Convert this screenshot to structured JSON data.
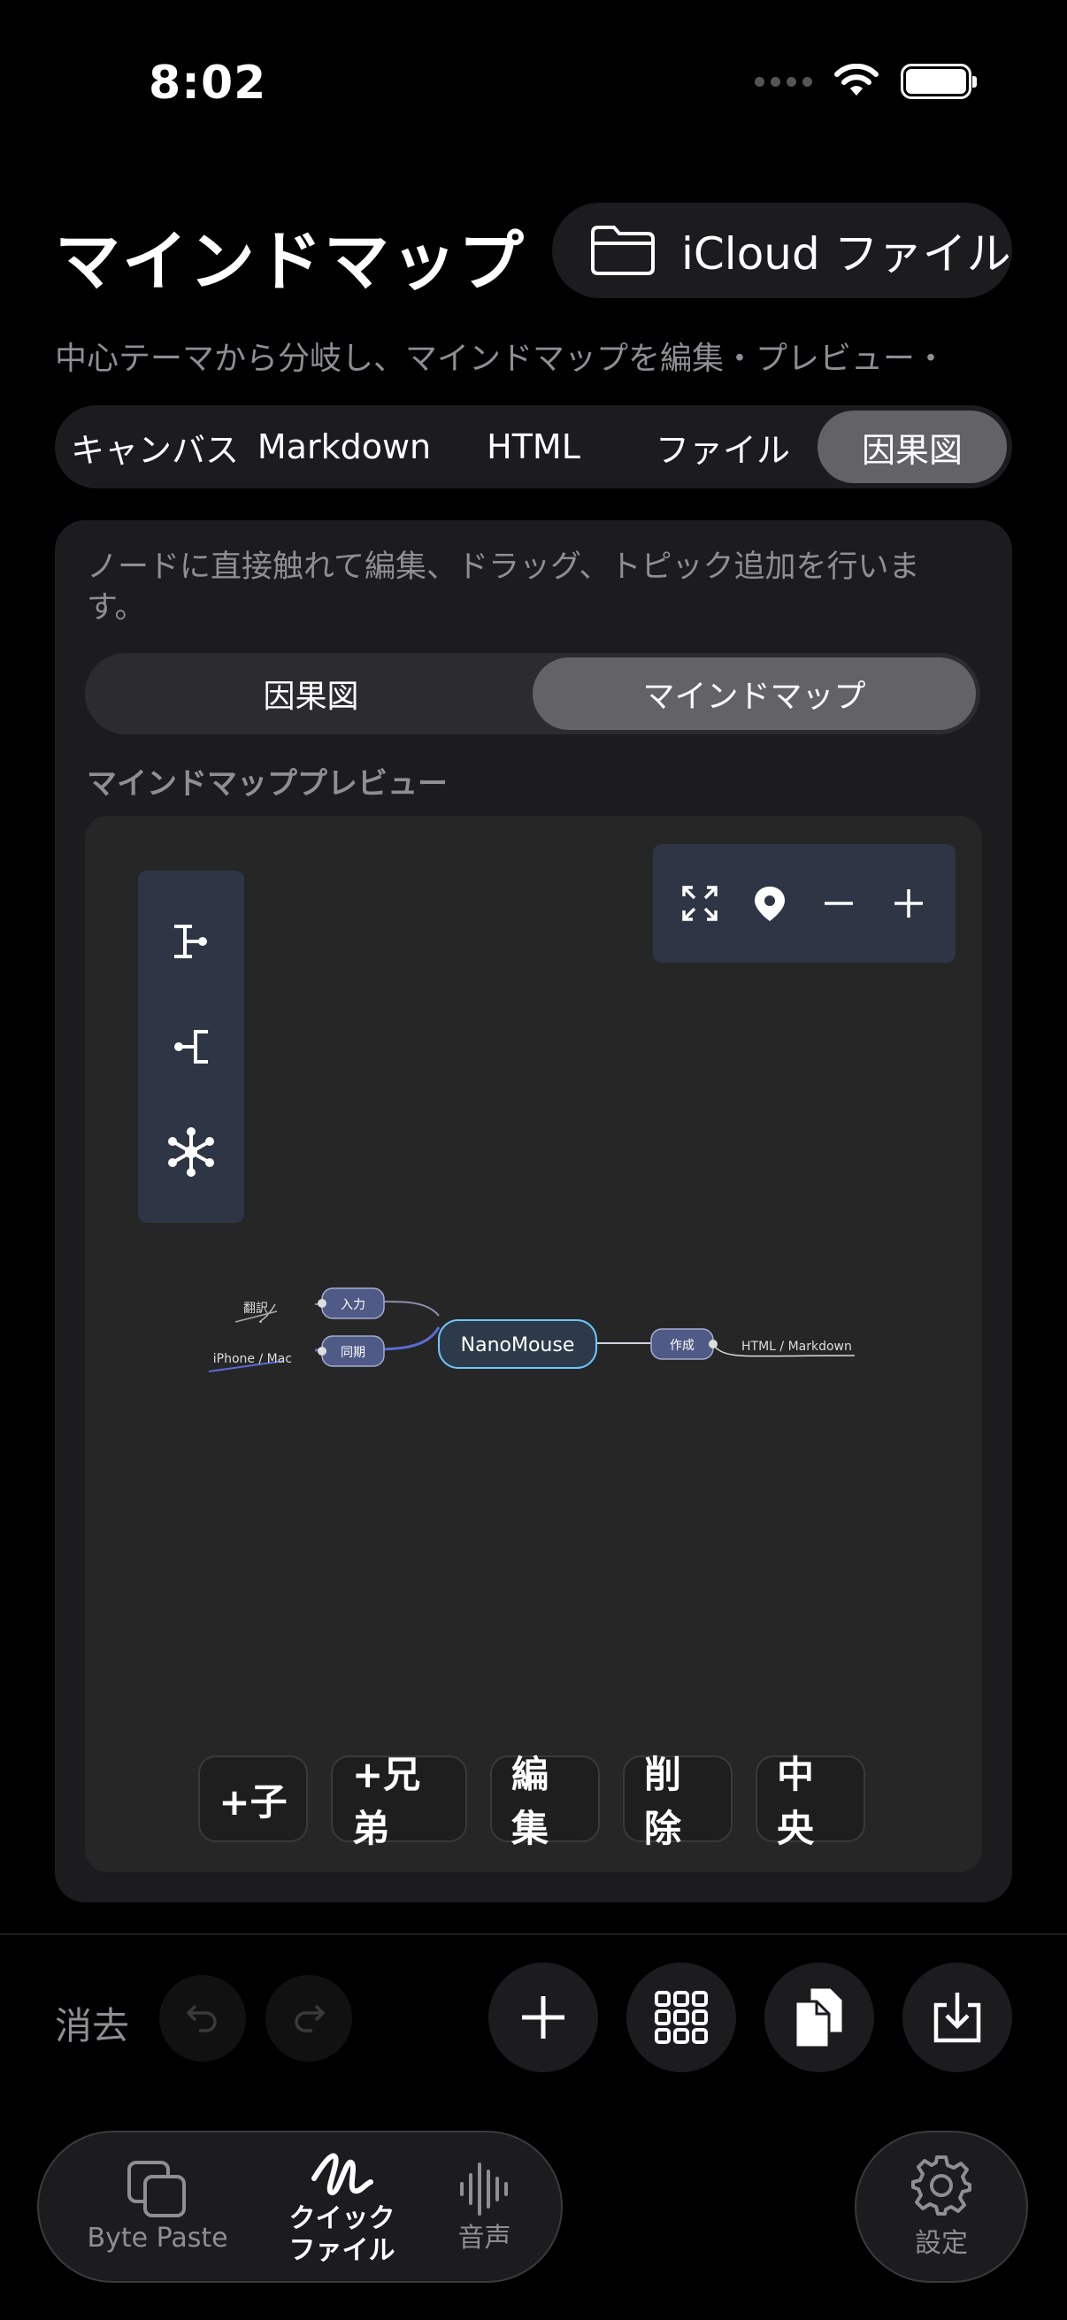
{
  "status": {
    "time": "8:02"
  },
  "header": {
    "title": "マインドマップ",
    "icloud_label": "iCloud ファイル"
  },
  "subtitle": "中心テーマから分岐し、マインドマップを編集・プレビュー・",
  "tabs": [
    {
      "label": "キャンバス",
      "active": false
    },
    {
      "label": "Markdown",
      "active": false
    },
    {
      "label": "HTML",
      "active": false
    },
    {
      "label": "ファイル",
      "active": false
    },
    {
      "label": "因果図",
      "active": true
    }
  ],
  "card": {
    "description": "ノードに直接触れて編集、ドラッグ、トピック追加を行います。",
    "toggle": [
      {
        "label": "因果図",
        "active": false
      },
      {
        "label": "マインドマップ",
        "active": true
      }
    ],
    "preview_label": "マインドマッププレビュー"
  },
  "mindmap": {
    "center": "NanoMouse",
    "nodes": {
      "input": "入力",
      "translate": "翻訳",
      "sync": "同期",
      "device": "iPhone / Mac",
      "create": "作成",
      "format": "HTML / Markdown"
    }
  },
  "node_actions": [
    "+子",
    "+兄弟",
    "編集",
    "削除",
    "中央"
  ],
  "bottom": {
    "clear_label": "消去"
  },
  "tabbar": [
    {
      "label": "Byte Paste",
      "icon": "copy-icon",
      "active": false
    },
    {
      "label": "クイック\nファイル",
      "icon": "scribble-icon",
      "active": true
    },
    {
      "label": "音声",
      "icon": "waveform-icon",
      "active": false
    }
  ],
  "settings_label": "設定",
  "colors": {
    "accent_node": "#4f5a86",
    "center_border": "#6ec6ff",
    "toolbar": "#2e3645"
  }
}
